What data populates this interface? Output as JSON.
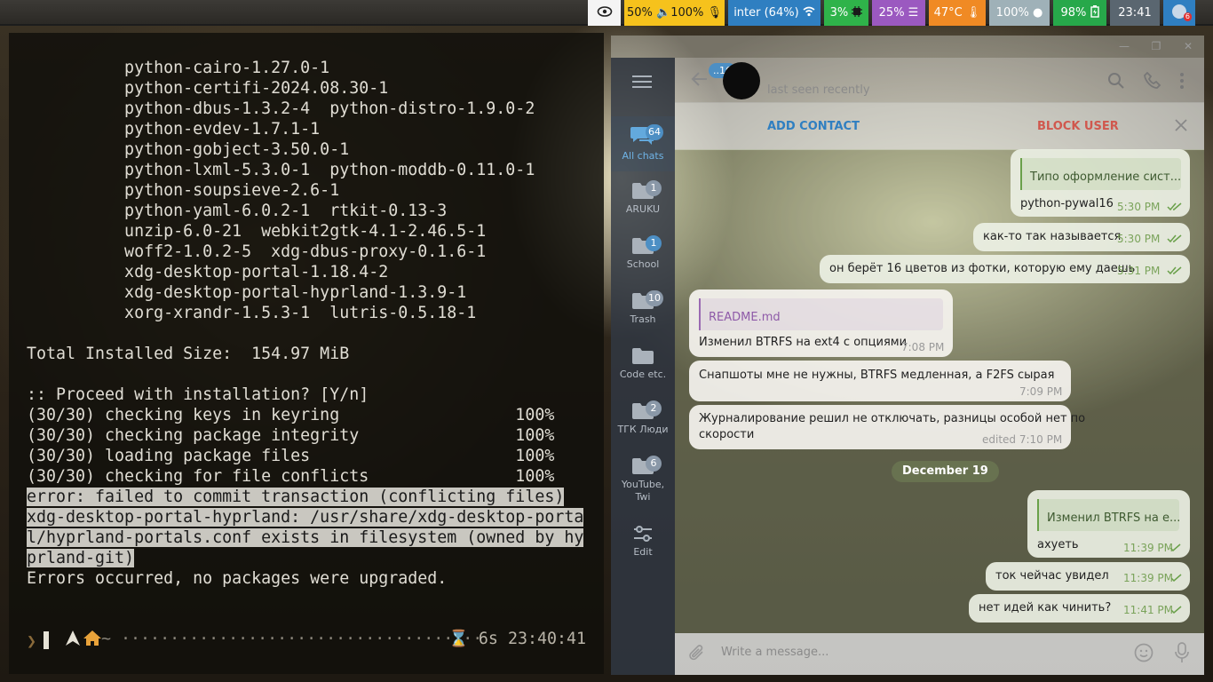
{
  "topbar": {
    "modules": [
      {
        "label": "",
        "icon": "eye-icon",
        "bg": "#f4f4f4",
        "fg": "#222222"
      },
      {
        "label": "50% 🔈100% 🎙",
        "bg": "#f6c21c",
        "fg": "#1a1a1a"
      },
      {
        "label": "inter (64%)",
        "icon": "wifi-icon",
        "bg": "#2f7fc1",
        "fg": "#ffffff"
      },
      {
        "label": "3%",
        "icon": "cpu-icon",
        "bg": "#2fb34a",
        "fg": "#ffffff"
      },
      {
        "label": "25% ☰",
        "bg": "#9b59c0",
        "fg": "#ffffff"
      },
      {
        "label": "47°C 🌡",
        "bg": "#f08a24",
        "fg": "#ffffff"
      },
      {
        "label": "100% ●",
        "bg": "#9fb1b8",
        "fg": "#ffffff"
      },
      {
        "label": "98%",
        "icon": "battery-charging-icon",
        "bg": "#27a84a",
        "fg": "#ffffff"
      },
      {
        "label": "23:41",
        "bg": "#5a6670",
        "fg": "#ffffff"
      },
      {
        "label": "6",
        "icon": "telegram-tray-icon",
        "bg": "#2f7fc1",
        "fg": "#ffffff"
      }
    ]
  },
  "terminal": {
    "lines": [
      "          python-cairo-1.27.0-1",
      "          python-certifi-2024.08.30-1",
      "          python-dbus-1.3.2-4  python-distro-1.9.0-2",
      "          python-evdev-1.7.1-1",
      "          python-gobject-3.50.0-1",
      "          python-lxml-5.3.0-1  python-moddb-0.11.0-1",
      "          python-soupsieve-2.6-1",
      "          python-yaml-6.0.2-1  rtkit-0.13-3",
      "          unzip-6.0-21  webkit2gtk-4.1-2.46.5-1",
      "          woff2-1.0.2-5  xdg-dbus-proxy-0.1.6-1",
      "          xdg-desktop-portal-1.18.4-2",
      "          xdg-desktop-portal-hyprland-1.3.9-1",
      "          xorg-xrandr-1.5.3-1  lutris-0.5.18-1",
      "",
      "Total Installed Size:  154.97 MiB",
      "",
      ":: Proceed with installation? [Y/n]",
      "(30/30) checking keys in keyring                  100%",
      "(30/30) checking package integrity                100%",
      "(30/30) loading package files                     100%",
      "(30/30) checking for file conflicts               100%"
    ],
    "highlighted": [
      "error: failed to commit transaction (conflicting files)",
      "xdg-desktop-portal-hyprland: /usr/share/xdg-desktop-porta",
      "l/hyprland-portals.conf exists in filesystem (owned by hy",
      "prland-git)"
    ],
    "after": "Errors occurred, no packages were upgraded.",
    "prompt_dots": "~ ·····································",
    "prompt_time": "⌛ 6s 23:40:41",
    "prompt_arrow": "❯"
  },
  "telegram": {
    "header": {
      "back_badge": "..16",
      "status": "last seen recently"
    },
    "actions": {
      "add_contact": "ADD CONTACT",
      "block_user": "BLOCK USER"
    },
    "folders": [
      {
        "label": "All chats",
        "badge": "64"
      },
      {
        "label": "ARUKU",
        "badge": "1"
      },
      {
        "label": "School",
        "badge": "1"
      },
      {
        "label": "Trash",
        "badge": "10"
      },
      {
        "label": "Code etc.",
        "badge": ""
      },
      {
        "label": "ТГК Люди",
        "badge": "2"
      },
      {
        "label": "YouTube,\nTwi",
        "badge": "6"
      },
      {
        "label": "Edit",
        "badge": ""
      }
    ],
    "messages": [
      {
        "reply": "Типо оформление сист...",
        "text": "python-pywal16",
        "time": "5:30 PM"
      },
      {
        "text": "как-то так называется",
        "time": "5:30 PM"
      },
      {
        "text": "он берёт 16 цветов из фотки, которую ему даешь",
        "time": "5:31 PM"
      },
      {
        "reply": "README.md",
        "text": "Изменил BTRFS на ext4 с опциями",
        "time": "7:08 PM"
      },
      {
        "text": "Снапшоты мне не нужны, BTRFS медленная, а F2FS сырая",
        "time": "7:09 PM"
      },
      {
        "text1": "Журналирование решил не отключать, разницы особой нет по",
        "text2": "скорости",
        "time": "edited 7:10 PM"
      },
      {
        "reply": "Изменил BTRFS на е...",
        "text": "ахуеть",
        "time": "11:39 PM"
      },
      {
        "text": "ток чейчас увидел",
        "time": "11:39 PM"
      },
      {
        "text": "нет идей как чинить?",
        "time": "11:41 PM"
      }
    ],
    "date_separator": "December 19",
    "compose_placeholder": "Write a message..."
  }
}
